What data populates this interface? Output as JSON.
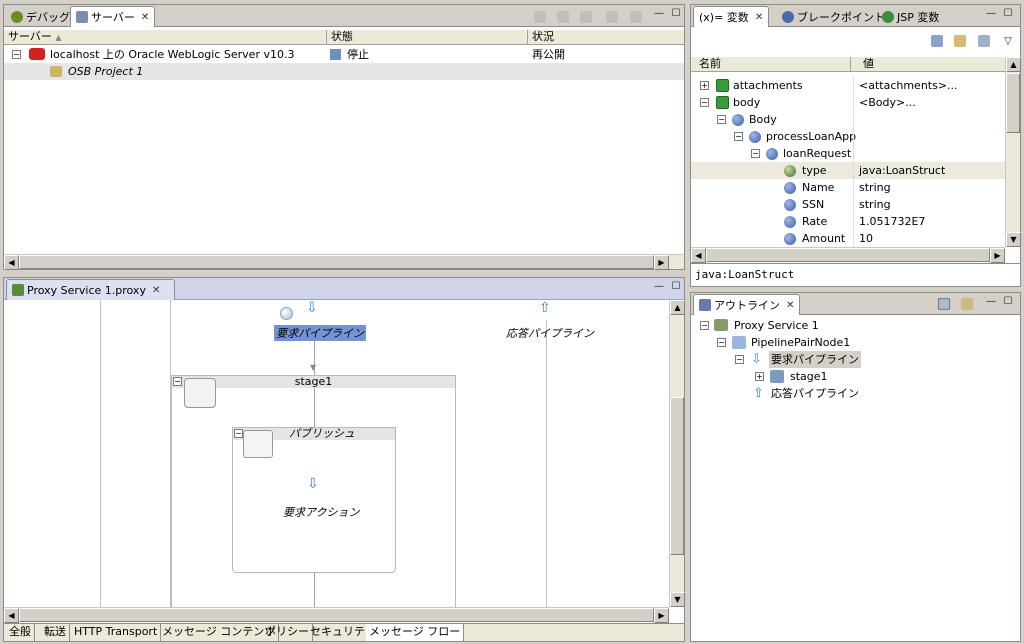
{
  "servers_pane": {
    "tabs": [
      {
        "label": "デバッグ"
      },
      {
        "label": "サーバー"
      }
    ],
    "columns": [
      "サーバー",
      "状態",
      "状況"
    ],
    "rows": [
      {
        "name": "localhost 上の Oracle WebLogic Server v10.3",
        "state": "停止",
        "status": "再公開"
      },
      {
        "name": "OSB Project 1",
        "state": "",
        "status": ""
      }
    ]
  },
  "variables_pane": {
    "tabs": [
      {
        "label": "(x)= 変数"
      },
      {
        "label": "ブレークポイント"
      },
      {
        "label": "JSP 変数"
      }
    ],
    "columns": [
      "名前",
      "値"
    ],
    "rows": [
      {
        "name": "attachments",
        "value": "<attachments>..."
      },
      {
        "name": "body",
        "value": "<Body>..."
      },
      {
        "name": "Body",
        "value": ""
      },
      {
        "name": "processLoanApp",
        "value": ""
      },
      {
        "name": "loanRequest",
        "value": ""
      },
      {
        "name": "type",
        "value": "java:LoanStruct"
      },
      {
        "name": "Name",
        "value": "string"
      },
      {
        "name": "SSN",
        "value": "string"
      },
      {
        "name": "Rate",
        "value": "1.051732E7"
      },
      {
        "name": "Amount",
        "value": "10"
      }
    ],
    "detail": "java:LoanStruct"
  },
  "editor_pane": {
    "tab": "Proxy Service 1.proxy",
    "request_pipeline": "要求パイプライン",
    "response_pipeline": "応答パイプライン",
    "stage": "stage1",
    "publish": "パブリッシュ",
    "request_action": "要求アクション",
    "bottom_tabs": [
      "全般",
      "転送",
      "HTTP Transport",
      "メッセージ コンテンツ",
      "ポリシー",
      "セキュリティ",
      "メッセージ フロー"
    ]
  },
  "outline_pane": {
    "tab": "アウトライン",
    "nodes": [
      {
        "label": "Proxy Service 1"
      },
      {
        "label": "PipelinePairNode1"
      },
      {
        "label": "要求パイプライン"
      },
      {
        "label": "stage1"
      },
      {
        "label": "応答パイプライン"
      }
    ]
  },
  "colors": {
    "accent": "#316ac5",
    "selection_bg": "#7394d4",
    "canvas_line": "#c0c0c0"
  }
}
